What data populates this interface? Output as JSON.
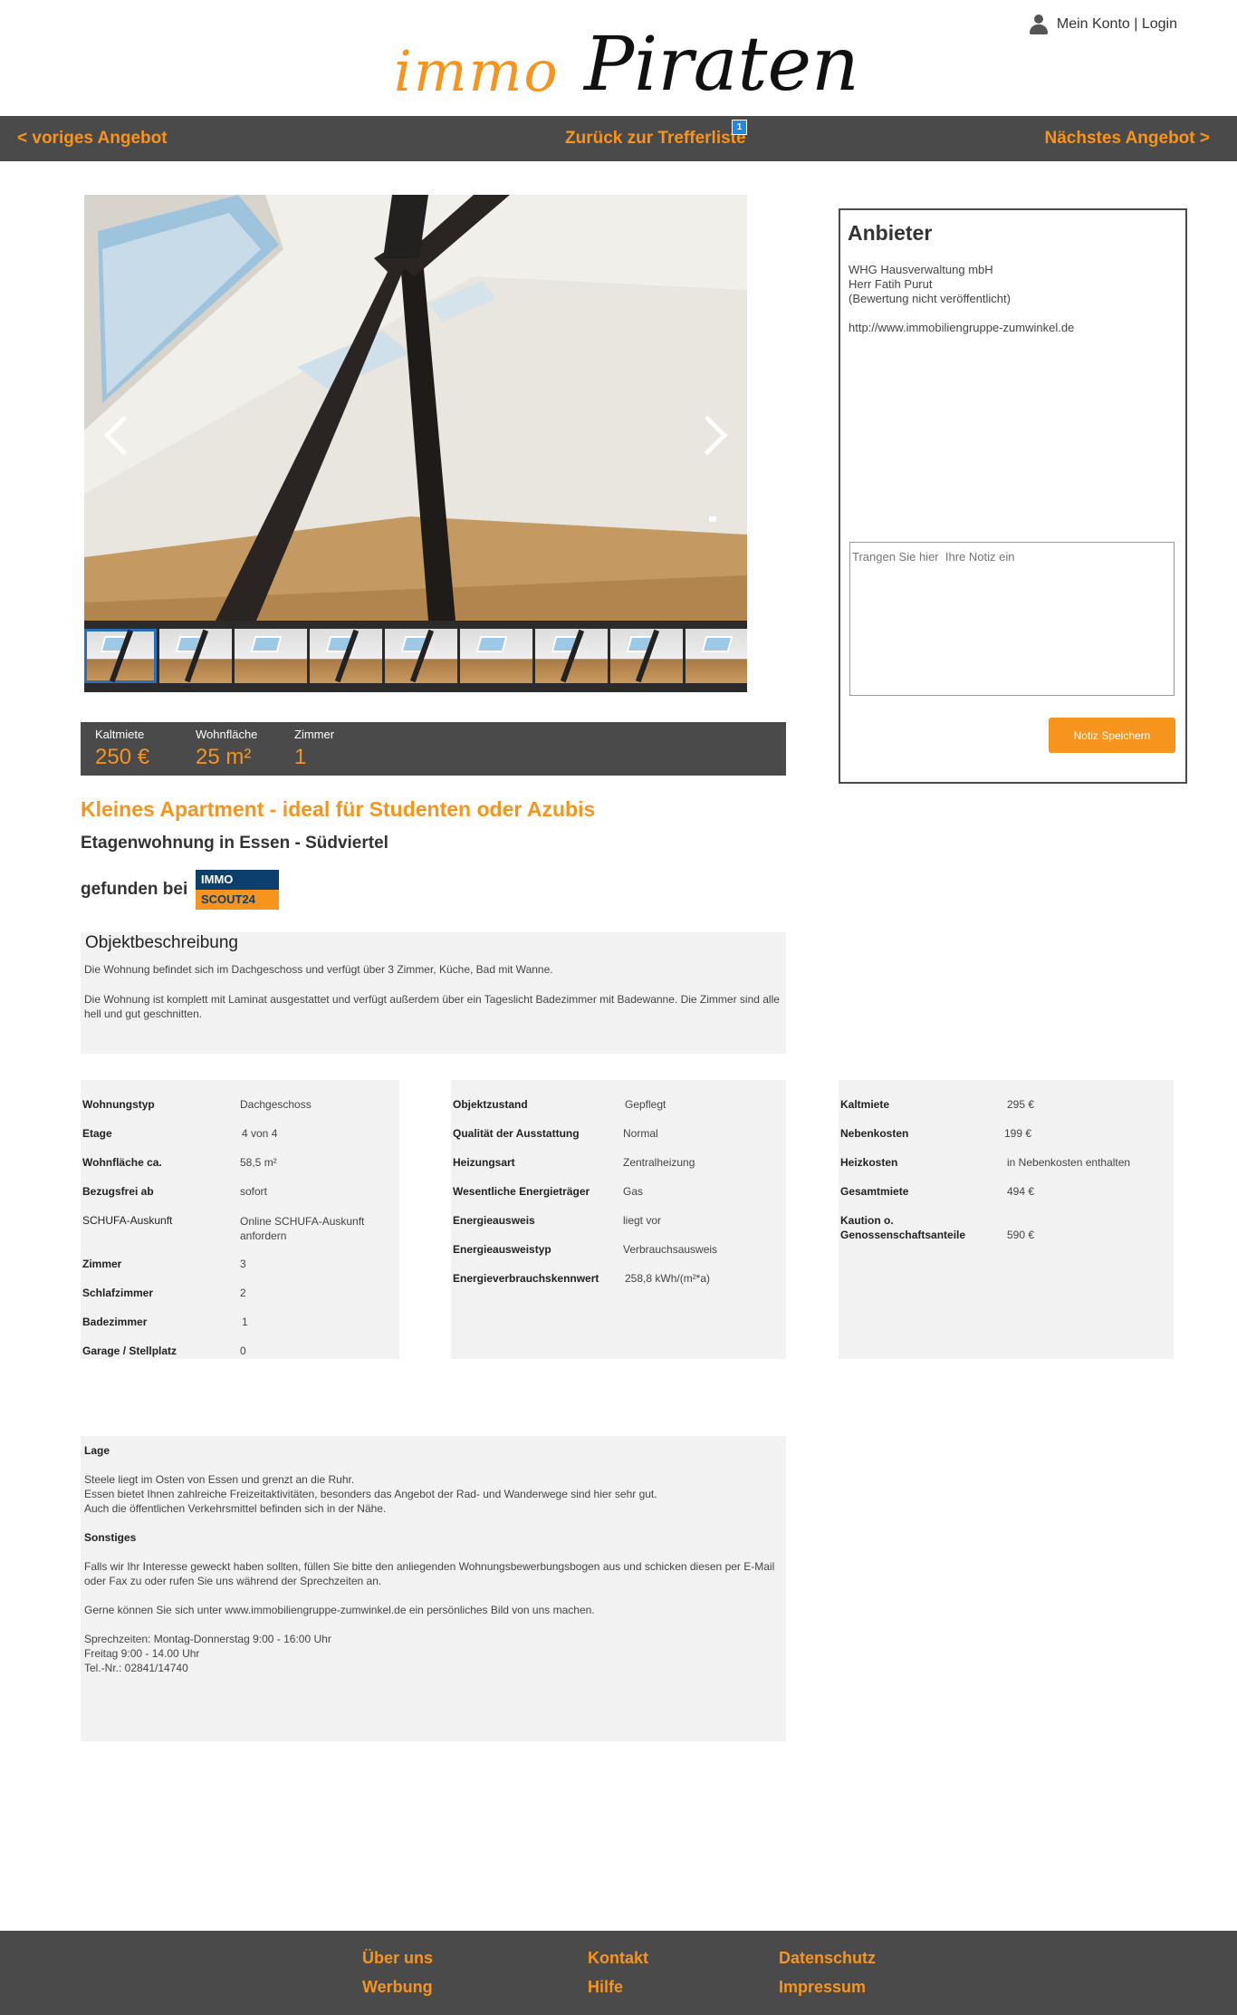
{
  "header": {
    "logo_immo": "immo",
    "logo_piraten": "Piraten",
    "account_label": "Mein Konto | Login"
  },
  "nav": {
    "prev": "< voriges Angebot",
    "back": "Zurück zur Trefferliste",
    "back_badge": "1",
    "next": "Nächstes Angebot >"
  },
  "gallery": {
    "thumb_count": 9,
    "active_index": 0
  },
  "facts": [
    {
      "label": "Kaltmiete",
      "value": "250 €"
    },
    {
      "label": "Wohnfläche",
      "value": "25 m²"
    },
    {
      "label": "Zimmer",
      "value": "1"
    }
  ],
  "listing": {
    "title": "Kleines Apartment - ideal für Studenten oder Azubis",
    "subtitle": "Etagenwohnung in Essen - Südviertel",
    "found_at": "gefunden bei",
    "source_logo_top": "IMMO",
    "source_logo_bottom": "SCOUT24"
  },
  "description": {
    "heading": "Objektbeschreibung",
    "p1": "Die Wohnung befindet sich im Dachgeschoss und verfügt über 3 Zimmer, Küche, Bad mit Wanne.",
    "p2": "Die Wohnung ist komplett mit Laminat ausgestattet und verfügt außerdem über ein Tageslicht Badezimmer mit Badewanne. Die Zimmer sind alle hell und gut geschnitten."
  },
  "details_1": [
    {
      "k": "Wohnungstyp",
      "v": "Dachgeschoss"
    },
    {
      "k": "Etage",
      "v": "4 von 4"
    },
    {
      "k": "Wohnfläche ca.",
      "v": "58,5 m²"
    },
    {
      "k": "Bezugsfrei ab",
      "v": "sofort"
    },
    {
      "k": "SCHUFA-Auskunft",
      "v": "Online SCHUFA-Auskunft anfordern"
    },
    {
      "k": "Zimmer",
      "v": "3"
    },
    {
      "k": "Schlafzimmer",
      "v": "2"
    },
    {
      "k": "Badezimmer",
      "v": "1"
    },
    {
      "k": "Garage / Stellplatz",
      "v": "0"
    }
  ],
  "details_2": [
    {
      "k": "Objektzustand",
      "v": "Gepflegt"
    },
    {
      "k": "Qualität der Ausstattung",
      "v": "Normal"
    },
    {
      "k": "Heizungsart",
      "v": "Zentralheizung"
    },
    {
      "k": "Wesentliche Energieträger",
      "v": "Gas"
    },
    {
      "k": "Energieausweis",
      "v": "liegt vor"
    },
    {
      "k": "Energieausweistyp",
      "v": "Verbrauchsausweis"
    },
    {
      "k": "Energieverbrauchskennwert",
      "v": "258,8 kWh/(m²*a)"
    }
  ],
  "details_3": [
    {
      "k": "Kaltmiete",
      "v": "295 €"
    },
    {
      "k": "Nebenkosten",
      "v": "199 €"
    },
    {
      "k": "Heizkosten",
      "v": "in Nebenkosten enthalten"
    },
    {
      "k": "Gesamtmiete",
      "v": "494 €"
    },
    {
      "k": "Kaution o.",
      "k2": "Genossenschaftsanteile",
      "v": "590 €"
    }
  ],
  "lage": {
    "heading": "Lage",
    "line1": "Steele liegt im Osten von Essen und grenzt an die Ruhr.",
    "line2": "Essen bietet Ihnen zahlreiche Freizeitaktivitäten, besonders das Angebot der Rad- und Wanderwege sind hier sehr gut.",
    "line3": "Auch die öffentlichen Verkehrsmittel befinden sich in der Nähe.",
    "sonstiges_heading": "Sonstiges",
    "sonstiges_p1": "Falls wir Ihr Interesse geweckt haben sollten, füllen Sie bitte den anliegenden Wohnungsbewerbungsbogen aus und schicken diesen per E-Mail oder Fax zu oder rufen Sie uns während der Sprechzeiten an.",
    "sonstiges_p2": "Gerne können Sie sich unter www.immobiliengruppe-zumwinkel.de ein persönliches Bild von uns machen.",
    "hours1": "Sprechzeiten: Montag-Donnerstag 9:00 - 16:00 Uhr",
    "hours2": "Freitag 9:00 - 14.00 Uhr",
    "phone": "Tel.-Nr.: 02841/14740"
  },
  "anbieter": {
    "heading": "Anbieter",
    "company": "WHG Hausverwaltung mbH",
    "person": "Herr Fatih Purut",
    "rating": "(Bewertung nicht veröffentlicht)",
    "url": "http://www.immobiliengruppe-zumwinkel.de",
    "note_placeholder": "Trangen Sie hier  Ihre Notiz ein",
    "save_label": "Notiz Speichern"
  },
  "footer": {
    "about": "Über uns",
    "contact": "Kontakt",
    "privacy": "Datenschutz",
    "ads": "Werbung",
    "help": "Hilfe",
    "imprint": "Impressum"
  }
}
